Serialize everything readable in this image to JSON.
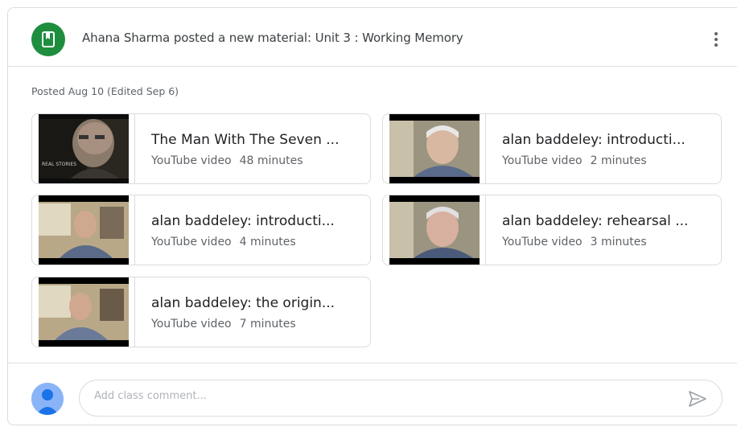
{
  "header": {
    "title": "Ahana Sharma posted a new material: Unit 3 : Working Memory",
    "icon": "bookmark-material-icon",
    "menu_icon": "more-vert-icon"
  },
  "posted": "Posted Aug 10 (Edited Sep 6)",
  "attachments": [
    {
      "title": "The Man With The Seven ...",
      "type": "YouTube video",
      "duration": "48 minutes",
      "thumb_text": "REAL STORIES"
    },
    {
      "title": "alan baddeley: introducti...",
      "type": "YouTube video",
      "duration": "2 minutes"
    },
    {
      "title": "alan baddeley: introducti...",
      "type": "YouTube video",
      "duration": "4 minutes"
    },
    {
      "title": "alan baddeley: rehearsal ...",
      "type": "YouTube video",
      "duration": "3 minutes"
    },
    {
      "title": "alan baddeley: the origin...",
      "type": "YouTube video",
      "duration": "7 minutes"
    }
  ],
  "comment": {
    "placeholder": "Add class comment...",
    "send_icon": "send-icon"
  },
  "colors": {
    "accent": "#1e8e3e",
    "border": "#dadce0",
    "text": "#202124",
    "muted": "#5f6368"
  }
}
